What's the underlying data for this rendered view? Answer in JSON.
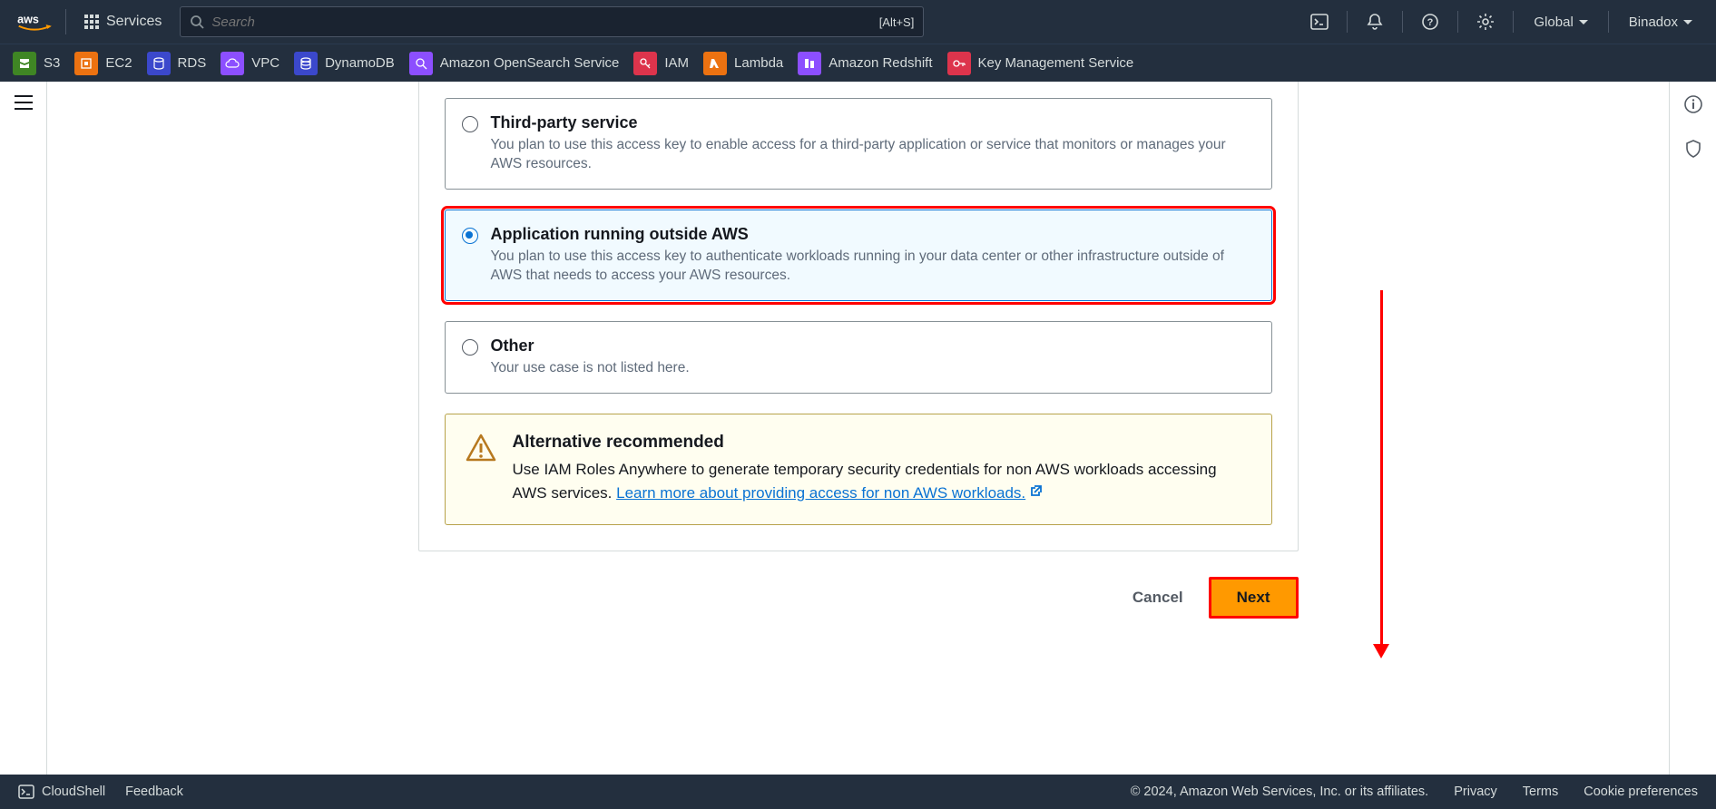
{
  "topnav": {
    "services_label": "Services",
    "search_placeholder": "Search",
    "search_shortcut": "[Alt+S]",
    "region": "Global",
    "account": "Binadox"
  },
  "svcbar": {
    "items": [
      {
        "key": "s3",
        "label": "S3"
      },
      {
        "key": "ec2",
        "label": "EC2"
      },
      {
        "key": "rds",
        "label": "RDS"
      },
      {
        "key": "vpc",
        "label": "VPC"
      },
      {
        "key": "dynamo",
        "label": "DynamoDB"
      },
      {
        "key": "open",
        "label": "Amazon OpenSearch Service"
      },
      {
        "key": "iam",
        "label": "IAM"
      },
      {
        "key": "lambda",
        "label": "Lambda"
      },
      {
        "key": "redshift",
        "label": "Amazon Redshift"
      },
      {
        "key": "kms",
        "label": "Key Management Service"
      }
    ]
  },
  "options": {
    "third_party": {
      "title": "Third-party service",
      "desc": "You plan to use this access key to enable access for a third-party application or service that monitors or manages your AWS resources."
    },
    "outside_aws": {
      "title": "Application running outside AWS",
      "desc": "You plan to use this access key to authenticate workloads running in your data center or other infrastructure outside of AWS that needs to access your AWS resources."
    },
    "other": {
      "title": "Other",
      "desc": "Your use case is not listed here."
    }
  },
  "alert": {
    "title": "Alternative recommended",
    "body_prefix": "Use IAM Roles Anywhere to generate temporary security credentials for non AWS workloads accessing AWS services. ",
    "link_text": "Learn more about providing access for non AWS workloads."
  },
  "actions": {
    "cancel": "Cancel",
    "next": "Next"
  },
  "footer": {
    "cloudshell": "CloudShell",
    "feedback": "Feedback",
    "copyright": "© 2024, Amazon Web Services, Inc. or its affiliates.",
    "privacy": "Privacy",
    "terms": "Terms",
    "cookies": "Cookie preferences"
  }
}
